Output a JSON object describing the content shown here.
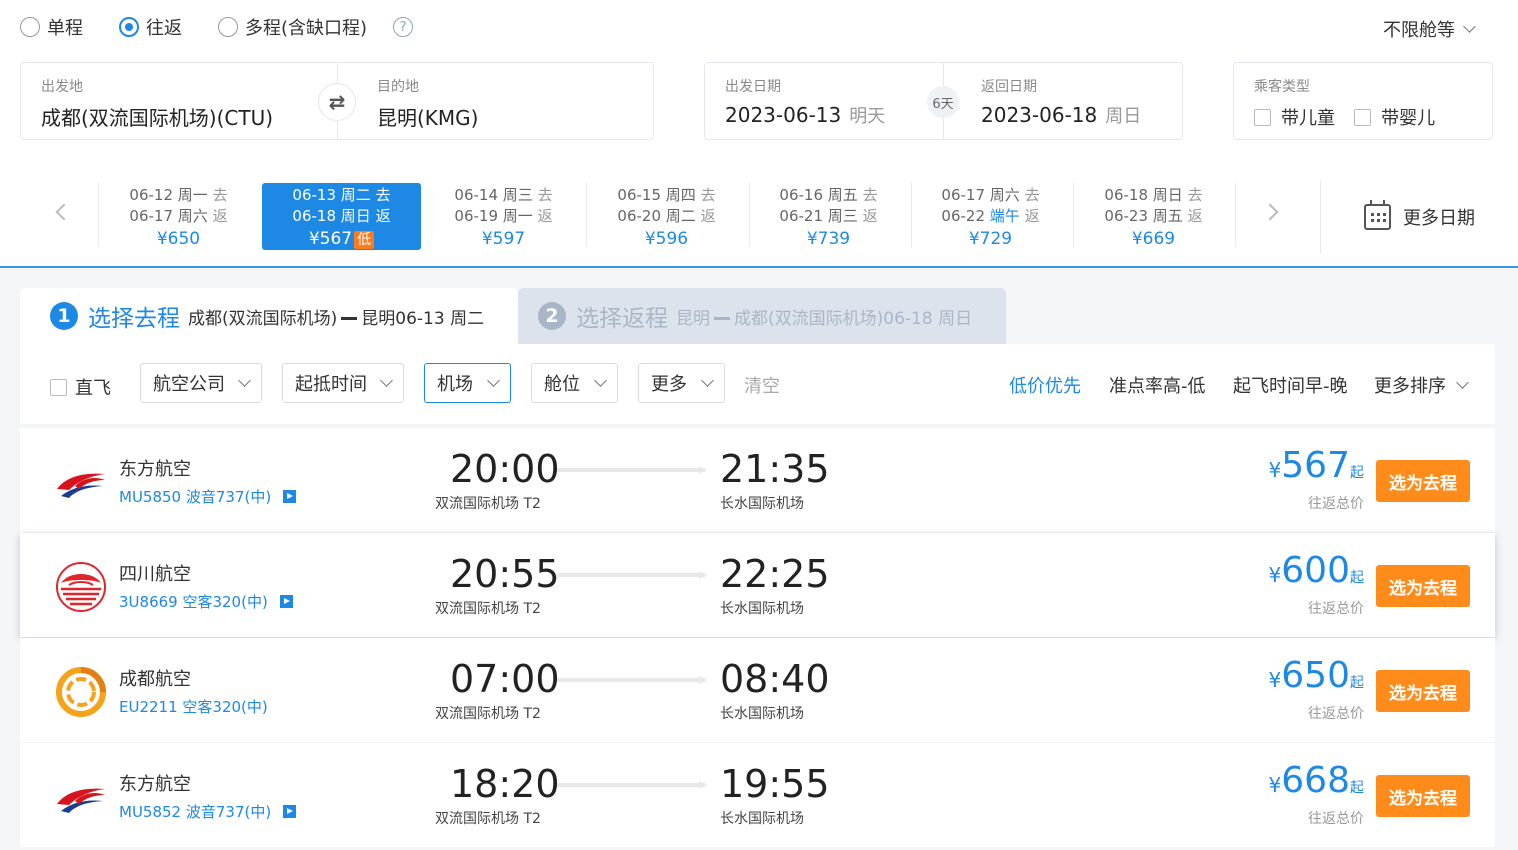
{
  "trip_types": [
    {
      "label": "单程",
      "checked": false
    },
    {
      "label": "往返",
      "checked": true
    },
    {
      "label": "多程(含缺口程)",
      "checked": false
    }
  ],
  "help_icon": "?",
  "cabin": "不限舱等",
  "origin": {
    "label": "出发地",
    "value": "成都(双流国际机场)(CTU)"
  },
  "destination": {
    "label": "目的地",
    "value": "昆明(KMG)"
  },
  "swap_icon": "⇄",
  "depart": {
    "label": "出发日期",
    "date": "2023-06-13",
    "day": "明天"
  },
  "trip_days": "6天",
  "return": {
    "label": "返回日期",
    "date": "2023-06-18",
    "day": "周日"
  },
  "passengers": {
    "label": "乘客类型",
    "child": "带儿童",
    "infant": "带婴儿"
  },
  "date_strip": [
    {
      "go": "06-12  周一",
      "go_tag": "去",
      "back": "06-17  周六",
      "back_tag": "返",
      "price": "¥650"
    },
    {
      "go": "06-13  周二",
      "go_tag": "去",
      "back": "06-18  周日",
      "back_tag": "返",
      "price": "¥567",
      "badge": "低",
      "active": true
    },
    {
      "go": "06-14  周三",
      "go_tag": "去",
      "back": "06-19  周一",
      "back_tag": "返",
      "price": "¥597"
    },
    {
      "go": "06-15  周四",
      "go_tag": "去",
      "back": "06-20  周二",
      "back_tag": "返",
      "price": "¥596"
    },
    {
      "go": "06-16  周五",
      "go_tag": "去",
      "back": "06-21  周三",
      "back_tag": "返",
      "price": "¥739"
    },
    {
      "go": "06-17  周六",
      "go_tag": "去",
      "back": "06-22  ",
      "back_holiday": "端午",
      "back_tag": "返",
      "price": "¥729"
    },
    {
      "go": "06-18  周日",
      "go_tag": "去",
      "back": "06-23  周五",
      "back_tag": "返",
      "price": "¥669"
    }
  ],
  "more_dates": "更多日期",
  "steps": {
    "one": {
      "num": "1",
      "title": "选择去程",
      "from": "成都(双流国际机场)",
      "to": "昆明06-13 周二"
    },
    "two": {
      "num": "2",
      "title": "选择返程",
      "from": "昆明",
      "to": "成都(双流国际机场)06-18 周日"
    }
  },
  "filters": {
    "direct": "直飞",
    "airline": "航空公司",
    "time": "起抵时间",
    "airport": "机场",
    "cabin": "舱位",
    "more": "更多",
    "clear": "清空"
  },
  "sorts": {
    "low_price": "低价优先",
    "punctual": "准点率高-低",
    "depart_time": "起飞时间早-晚",
    "more_sort": "更多排序"
  },
  "flights": [
    {
      "airline": "东方航空",
      "info": "MU5850 波音737(中)",
      "has_play": true,
      "dep_time": "20:00",
      "dep_airport": "双流国际机场 T2",
      "arr_time": "21:35",
      "arr_airport": "长水国际机场",
      "yen": "¥",
      "price": "567",
      "qi": "起",
      "price_note": "往返总价",
      "btn": "选为去程",
      "logo": "china-eastern"
    },
    {
      "airline": "四川航空",
      "info": "3U8669 空客320(中)",
      "has_play": true,
      "dep_time": "20:55",
      "dep_airport": "双流国际机场 T2",
      "arr_time": "22:25",
      "arr_airport": "长水国际机场",
      "yen": "¥",
      "price": "600",
      "qi": "起",
      "price_note": "往返总价",
      "btn": "选为去程",
      "logo": "sichuan"
    },
    {
      "airline": "成都航空",
      "info": "EU2211 空客320(中)",
      "has_play": false,
      "dep_time": "07:00",
      "dep_airport": "双流国际机场 T2",
      "arr_time": "08:40",
      "arr_airport": "长水国际机场",
      "yen": "¥",
      "price": "650",
      "qi": "起",
      "price_note": "往返总价",
      "btn": "选为去程",
      "logo": "chengdu"
    },
    {
      "airline": "东方航空",
      "info": "MU5852 波音737(中)",
      "has_play": true,
      "dep_time": "18:20",
      "dep_airport": "双流国际机场 T2",
      "arr_time": "19:55",
      "arr_airport": "长水国际机场",
      "yen": "¥",
      "price": "668",
      "qi": "起",
      "price_note": "往返总价",
      "btn": "选为去程",
      "logo": "china-eastern"
    }
  ]
}
